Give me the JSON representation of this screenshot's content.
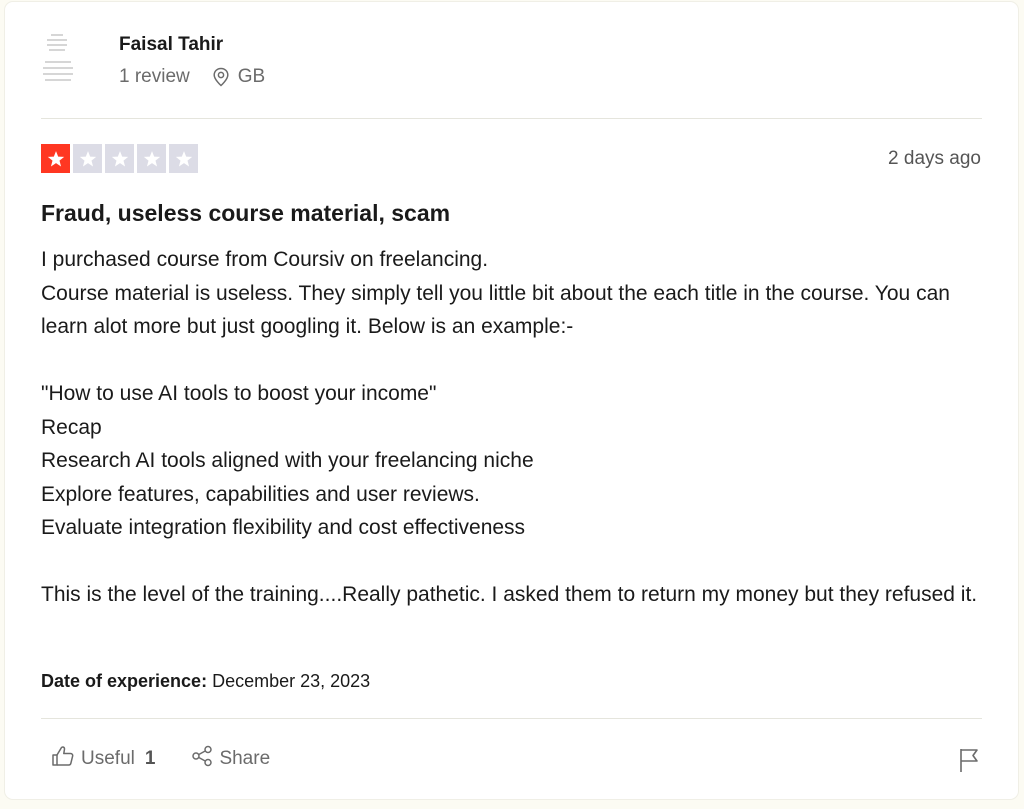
{
  "reviewer": {
    "name": "Faisal Tahir",
    "review_count": "1 review",
    "location": "GB"
  },
  "review": {
    "rating": 1,
    "max_rating": 5,
    "date": "2 days ago",
    "title": "Fraud, useless course material, scam",
    "body_lines": [
      "I purchased course from Coursiv on freelancing.",
      "Course material is useless. They simply tell you little bit about the each title in the course. You can learn alot more but just googling it. Below is an example:-",
      "",
      "\"How to use AI tools to boost your income\"",
      "Recap",
      "Research AI tools aligned with your freelancing niche",
      "Explore features, capabilities and user reviews.",
      "Evaluate integration flexibility and cost effectiveness",
      "",
      "This is the level of the training....Really pathetic. I asked them to return my money but they refused it."
    ],
    "date_of_experience_label": "Date of experience:",
    "date_of_experience": "December 23, 2023"
  },
  "actions": {
    "useful_label": "Useful",
    "useful_count": "1",
    "share_label": "Share"
  },
  "colors": {
    "star_filled": "#ff3722",
    "star_empty": "#dcdce6",
    "muted_text": "#6b6b6b"
  },
  "icons": [
    "avatar-placeholder-icon",
    "location-pin-icon",
    "star-icon",
    "thumbs-up-icon",
    "share-icon",
    "flag-icon"
  ]
}
